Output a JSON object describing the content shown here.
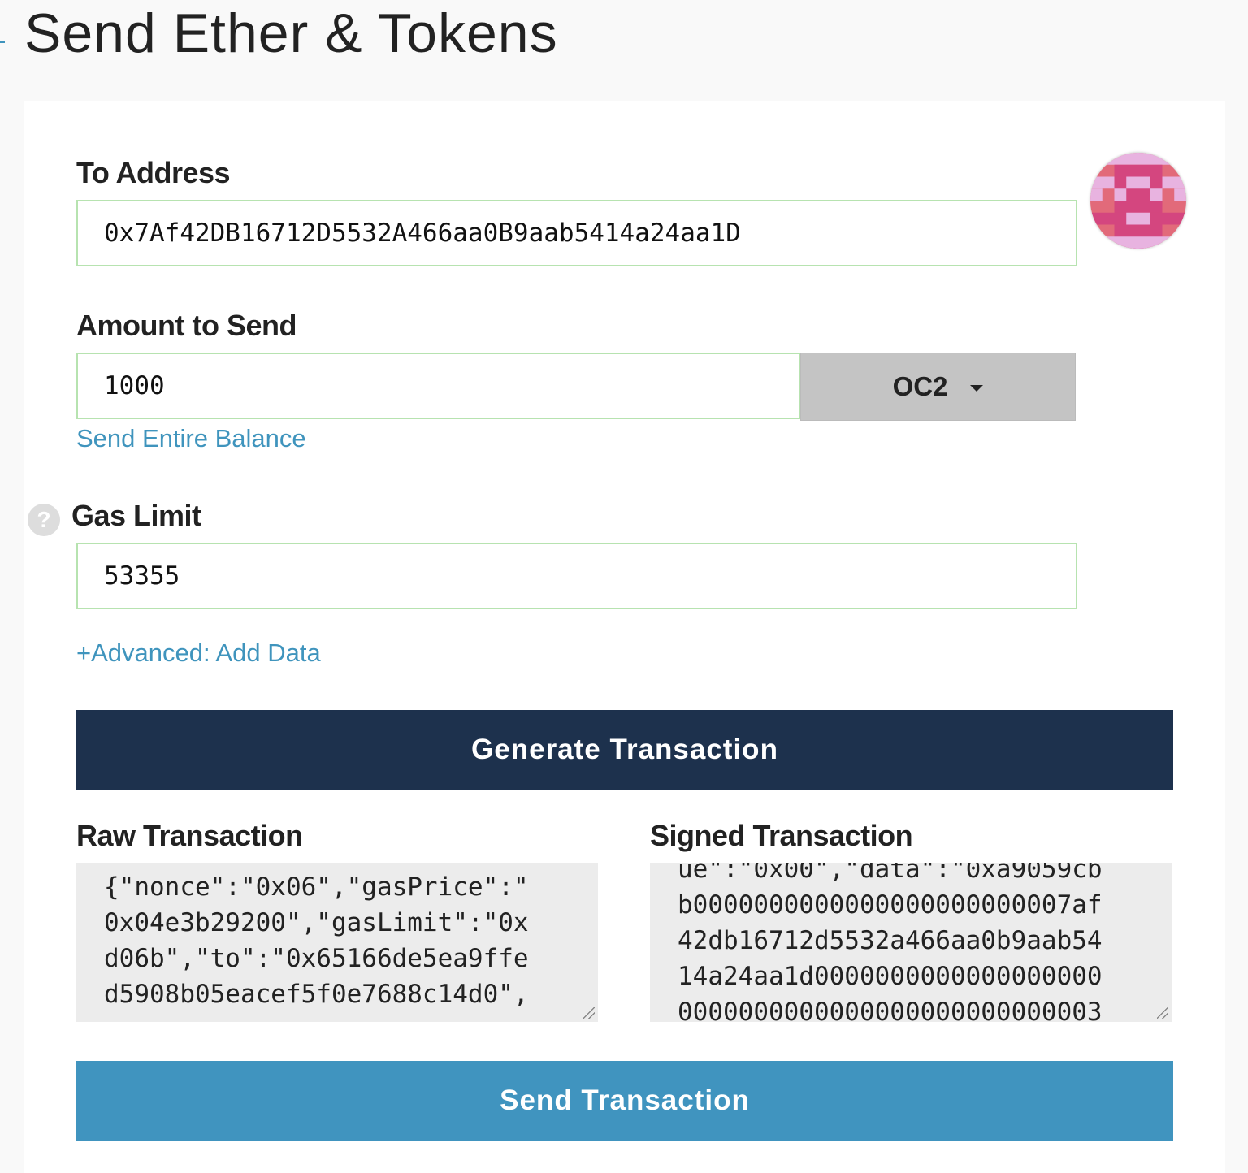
{
  "page": {
    "title": "Send Ether & Tokens"
  },
  "to_address": {
    "label": "To Address",
    "value": "0x7Af42DB16712D5532A466aa0B9aab5414a24aa1D",
    "identicon_colors": [
      "#e26a7a",
      "#d4467f",
      "#e8b3e0"
    ]
  },
  "amount": {
    "label": "Amount to Send",
    "value": "1000",
    "token": "OC2",
    "send_entire_balance": "Send Entire Balance"
  },
  "gas": {
    "label": "Gas Limit",
    "value": "53355",
    "help_icon": "?"
  },
  "advanced_link": "+Advanced: Add Data",
  "generate_button": "Generate Transaction",
  "raw": {
    "label": "Raw Transaction",
    "lines": [
      "{\"nonce\":\"0x06\",\"gasPrice\":\"",
      "0x04e3b29200\",\"gasLimit\":\"0x",
      "d06b\",\"to\":\"0x65166de5ea9ffe",
      "d5908b05eacef5f0e7688c14d0\","
    ]
  },
  "signed": {
    "label": "Signed Transaction",
    "lines": [
      "ue\":\"0x00\",\"data\":\"0xa9059cb",
      "b0000000000000000000000007af",
      "42db16712d5532a466aa0b9aab54",
      "14a24aa1d0000000000000000000",
      "0000000000000000000000000003"
    ]
  },
  "send_button": "Send Transaction",
  "colors": {
    "accent": "#3f94bd",
    "navy": "#1d314d",
    "input_border": "#b7e3b0"
  }
}
